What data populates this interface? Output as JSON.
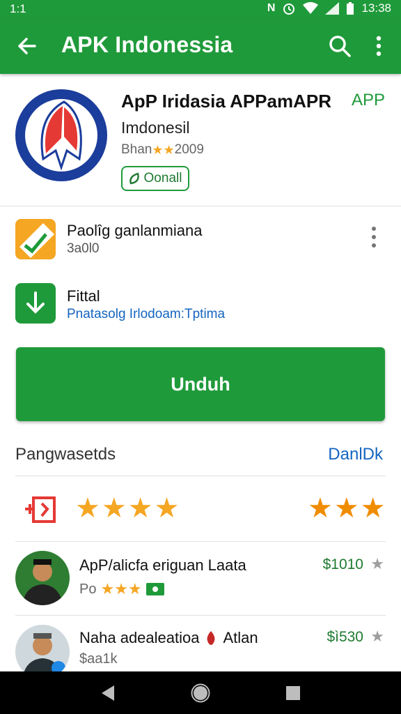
{
  "status_bar": {
    "left": "1:1",
    "time": "13:38"
  },
  "app_bar": {
    "title": "APK Indonessia"
  },
  "app_header": {
    "name": "ApP Iridasia APPamAPR",
    "tag": "APP",
    "developer": "Imdonesil",
    "rating_prefix": "Bhan",
    "rating_stars": "★★",
    "rating_year": "2009",
    "install_chip_label": "Oonall"
  },
  "list_rows": [
    {
      "title": "Paolîg ganlanmiana",
      "subtitle": "3a0l0"
    },
    {
      "title": "Fittal",
      "subtitle": "Pnatasolg Irlodoam:Tptima"
    }
  ],
  "main_button": {
    "label": "Unduh"
  },
  "reviews_section": {
    "title": "Pangwasetds",
    "link": "DanlDk",
    "left_stars": "★★★★",
    "right_stars": "★★★"
  },
  "reviews": [
    {
      "name": "ApP/alicfa eriguan Laata",
      "sub_prefix": "Po",
      "sub_stars": "★★★",
      "price": "$1010",
      "star": "★"
    },
    {
      "name": "Naha adealeatioa",
      "name_suffix": "Atlan",
      "sub": "$aa1k",
      "price": "$ì530",
      "star": "★"
    }
  ],
  "colors": {
    "primary": "#1f9a3a",
    "accent_link": "#1565c0",
    "star": "#f5a623"
  }
}
